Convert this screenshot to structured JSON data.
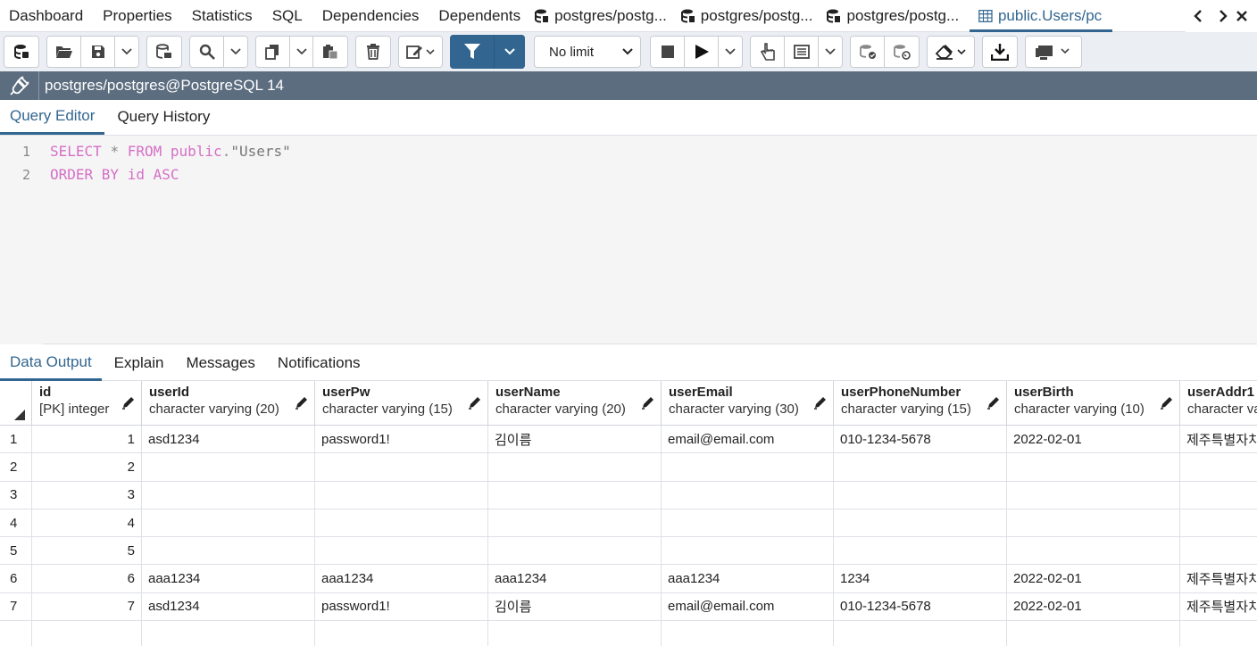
{
  "top_tabs": {
    "items": [
      {
        "label": "Dashboard"
      },
      {
        "label": "Properties"
      },
      {
        "label": "Statistics"
      },
      {
        "label": "SQL"
      },
      {
        "label": "Dependencies"
      },
      {
        "label": "Dependents"
      }
    ],
    "db_tabs": [
      {
        "label": "postgres/postg..."
      },
      {
        "label": "postgres/postg..."
      },
      {
        "label": "postgres/postg..."
      }
    ],
    "active_tab": {
      "label": "public.Users/pc"
    }
  },
  "toolbar": {
    "limit_select": "No limit",
    "filter_color": "#326690"
  },
  "connection": {
    "label": "postgres/postgres@PostgreSQL 14",
    "bar_color": "#5b6d7f"
  },
  "editor_tabs": [
    {
      "label": "Query Editor"
    },
    {
      "label": "Query History"
    }
  ],
  "editor": {
    "lines": [
      {
        "num": "1"
      },
      {
        "num": "2"
      }
    ],
    "line1": {
      "select": "SELECT",
      "star": "*",
      "from": "FROM",
      "schema": "public",
      "dot": ".",
      "table": "\"Users\""
    },
    "line2": {
      "order": "ORDER BY",
      "col": "id",
      "dir": "ASC"
    }
  },
  "result_tabs": [
    {
      "label": "Data Output"
    },
    {
      "label": "Explain"
    },
    {
      "label": "Messages"
    },
    {
      "label": "Notifications"
    }
  ],
  "grid": {
    "columns": [
      {
        "name": "id",
        "type": "[PK] integer"
      },
      {
        "name": "userId",
        "type": "character varying (20)"
      },
      {
        "name": "userPw",
        "type": "character varying (15)"
      },
      {
        "name": "userName",
        "type": "character varying (20)"
      },
      {
        "name": "userEmail",
        "type": "character varying (30)"
      },
      {
        "name": "userPhoneNumber",
        "type": "character varying (15)"
      },
      {
        "name": "userBirth",
        "type": "character varying (10)"
      },
      {
        "name": "userAddr1",
        "type": "character va"
      }
    ],
    "rows": [
      {
        "rn": "1",
        "cells": [
          "1",
          "asd1234",
          "password1!",
          "김이름",
          "email@email.com",
          "010-1234-5678",
          "2022-02-01",
          "제주특별자치"
        ]
      },
      {
        "rn": "2",
        "cells": [
          "2",
          "",
          "",
          "",
          "",
          "",
          "",
          ""
        ]
      },
      {
        "rn": "3",
        "cells": [
          "3",
          "",
          "",
          "",
          "",
          "",
          "",
          ""
        ]
      },
      {
        "rn": "4",
        "cells": [
          "4",
          "",
          "",
          "",
          "",
          "",
          "",
          ""
        ]
      },
      {
        "rn": "5",
        "cells": [
          "5",
          "",
          "",
          "",
          "",
          "",
          "",
          ""
        ]
      },
      {
        "rn": "6",
        "cells": [
          "6",
          "aaa1234",
          "aaa1234",
          "aaa1234",
          "aaa1234",
          "1234",
          "2022-02-01",
          "제주특별자치"
        ]
      },
      {
        "rn": "7",
        "cells": [
          "7",
          "asd1234",
          "password1!",
          "김이름",
          "email@email.com",
          "010-1234-5678",
          "2022-02-01",
          "제주특별자치"
        ]
      }
    ]
  }
}
